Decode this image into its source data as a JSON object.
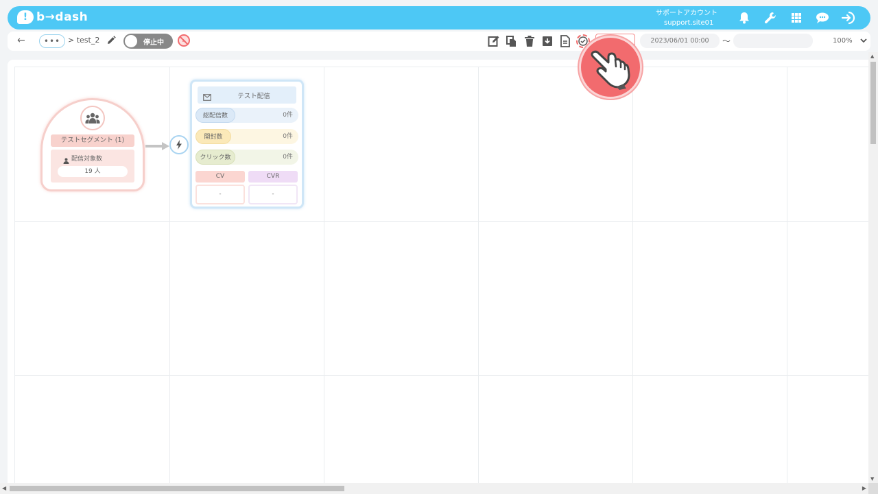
{
  "app": {
    "logo_mark": "!",
    "logo_text": "b→dash",
    "account_name": "サポートアカウント",
    "account_site": "support.site01",
    "top_icons": [
      "bell-icon",
      "wrench-icon",
      "grid-apps-icon",
      "chat-icon",
      "logout-icon"
    ],
    "brand_color": "#4dc8f5"
  },
  "toolbar": {
    "back_icon": "←",
    "more_label": "•••",
    "breadcrumb": "> test_2",
    "status_toggle": "停止中",
    "date_start": "2023/06/01 00:00",
    "date_separator": "〜",
    "date_end": "",
    "zoom": "100%",
    "actions": [
      "edit-icon",
      "copy-icon",
      "trash-icon",
      "archive-icon",
      "document-icon",
      "check-circle-icon"
    ]
  },
  "canvas": {
    "segment_node": {
      "icon": "group-icon",
      "title": "テストセグメント (1)",
      "target_label": "配信対象数",
      "target_count": "19 人"
    },
    "trigger_icon": "lightning-icon",
    "mail_node": {
      "icon": "envelope-icon",
      "title": "テスト配信",
      "metrics": [
        {
          "label": "総配信数",
          "value": "0件"
        },
        {
          "label": "開封数",
          "value": "0件"
        },
        {
          "label": "クリック数",
          "value": "0件"
        }
      ],
      "cv_label": "CV",
      "cvr_label": "CVR",
      "cv_value": "-",
      "cvr_value": "-"
    }
  },
  "pointer": {
    "icon": "hand-pointer-icon",
    "color": "#f26b6e"
  }
}
